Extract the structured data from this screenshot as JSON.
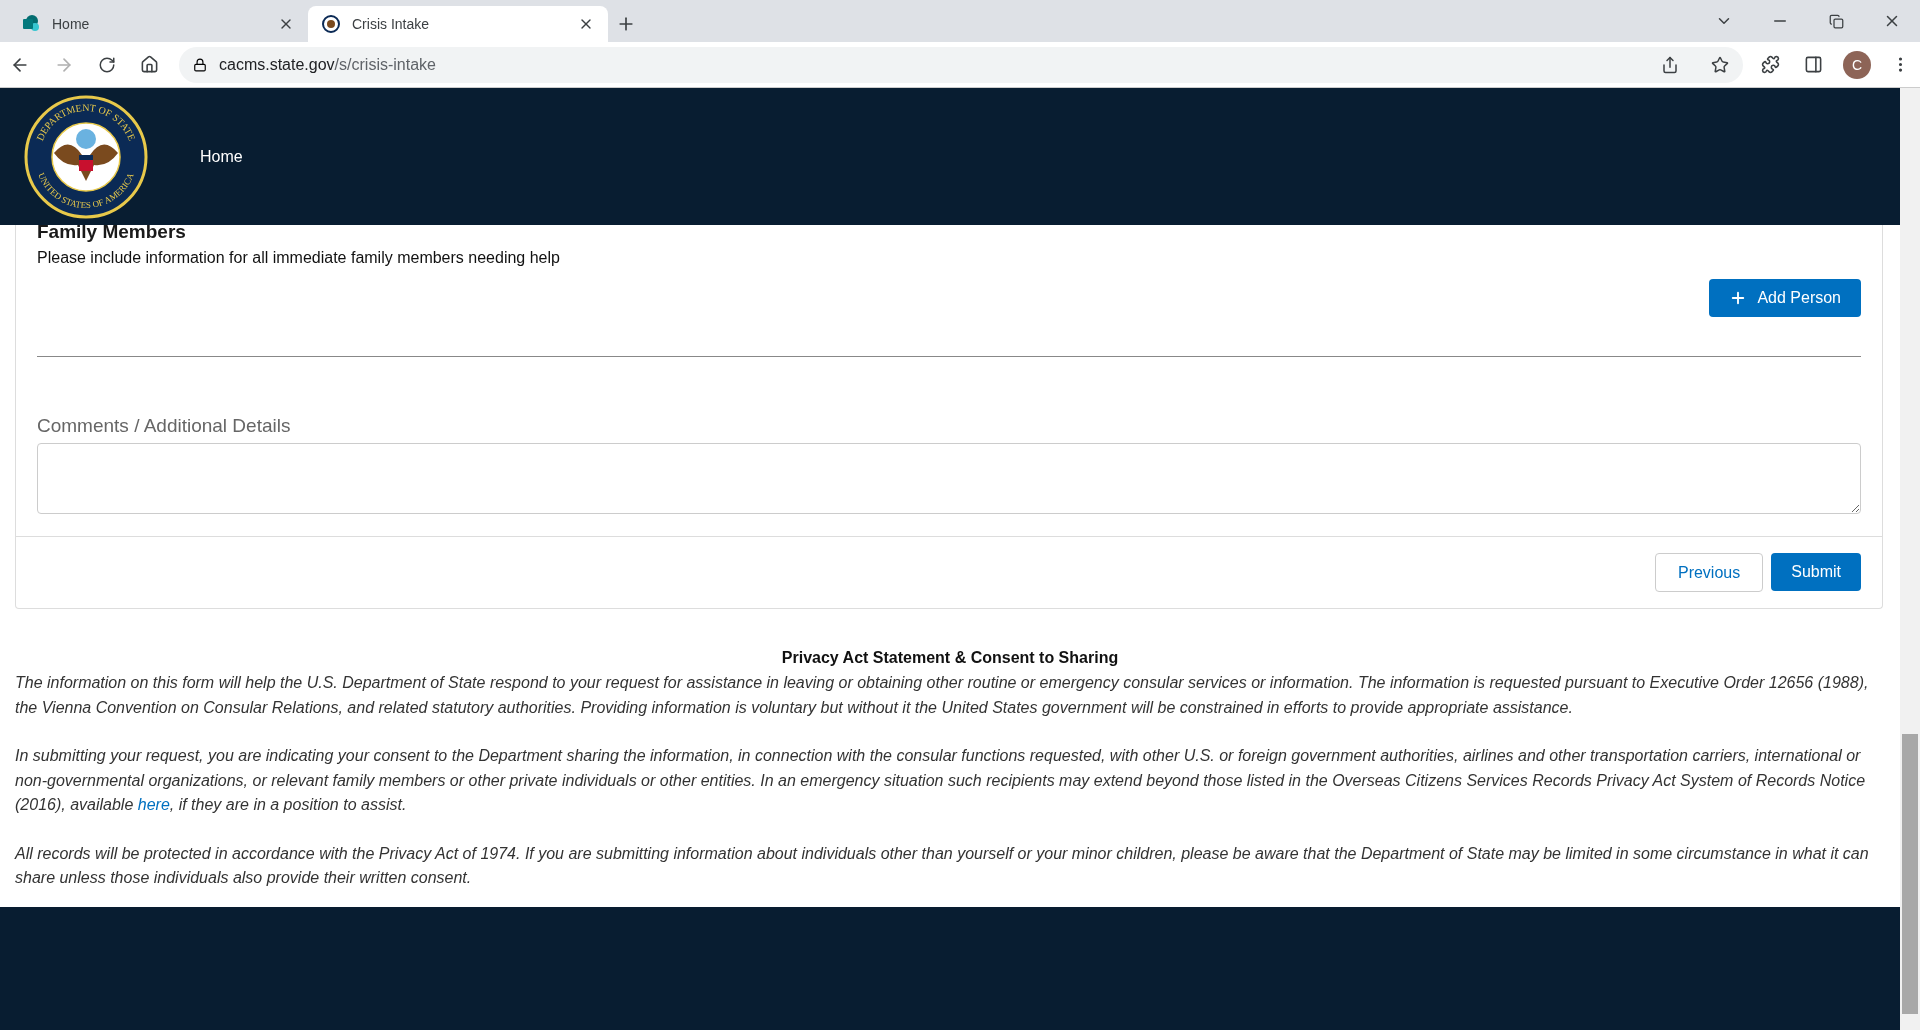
{
  "browser": {
    "tabs": [
      {
        "title": "Home",
        "selected": false,
        "kind": "sharepoint"
      },
      {
        "title": "Crisis Intake",
        "selected": true,
        "kind": "seal"
      }
    ],
    "url_host": "cacms.state.gov",
    "url_path": "/s/crisis-intake",
    "profile_initial": "C"
  },
  "header": {
    "seal_top": "DEPARTMENT OF STATE",
    "seal_bottom": "UNITED STATES OF AMERICA",
    "nav": [
      {
        "label": "Home"
      }
    ]
  },
  "family": {
    "title": "Family Members",
    "hint": "Please include information for all immediate family members needing help",
    "add_button": "Add Person"
  },
  "comments": {
    "label": "Comments / Additional Details"
  },
  "actions": {
    "previous": "Previous",
    "submit": "Submit"
  },
  "privacy": {
    "title": "Privacy Act Statement & Consent to Sharing",
    "paragraphs": [
      {
        "text": "The information on this form will help the U.S. Department of State respond to your request for assistance in leaving or obtaining other routine or emergency consular services or information. The information is requested pursuant to Executive Order 12656 (1988), the Vienna Convention on Consular Relations, and related statutory authorities. Providing information is voluntary but without it the United States government will be constrained in efforts to provide appropriate assistance."
      },
      {
        "text": "In submitting your request, you are indicating your consent to the Department sharing the information, in connection with the consular functions requested, with other U.S. or foreign government authorities, airlines and other transportation carriers, international or non-governmental organizations, or relevant family members or other private individuals or other entities. In an emergency situation such recipients may extend beyond those listed in the Overseas Citizens Services Records Privacy Act System of Records Notice (2016), available ",
        "link": "here",
        "after": ", if they are in a position to assist."
      },
      {
        "text": "All records will be protected in accordance with the Privacy Act of 1974. If you are submitting information about individuals other than yourself or your minor children, please be aware that the Department of State may be limited in some circumstance in what it can share unless those individuals also provide their written consent."
      }
    ]
  }
}
